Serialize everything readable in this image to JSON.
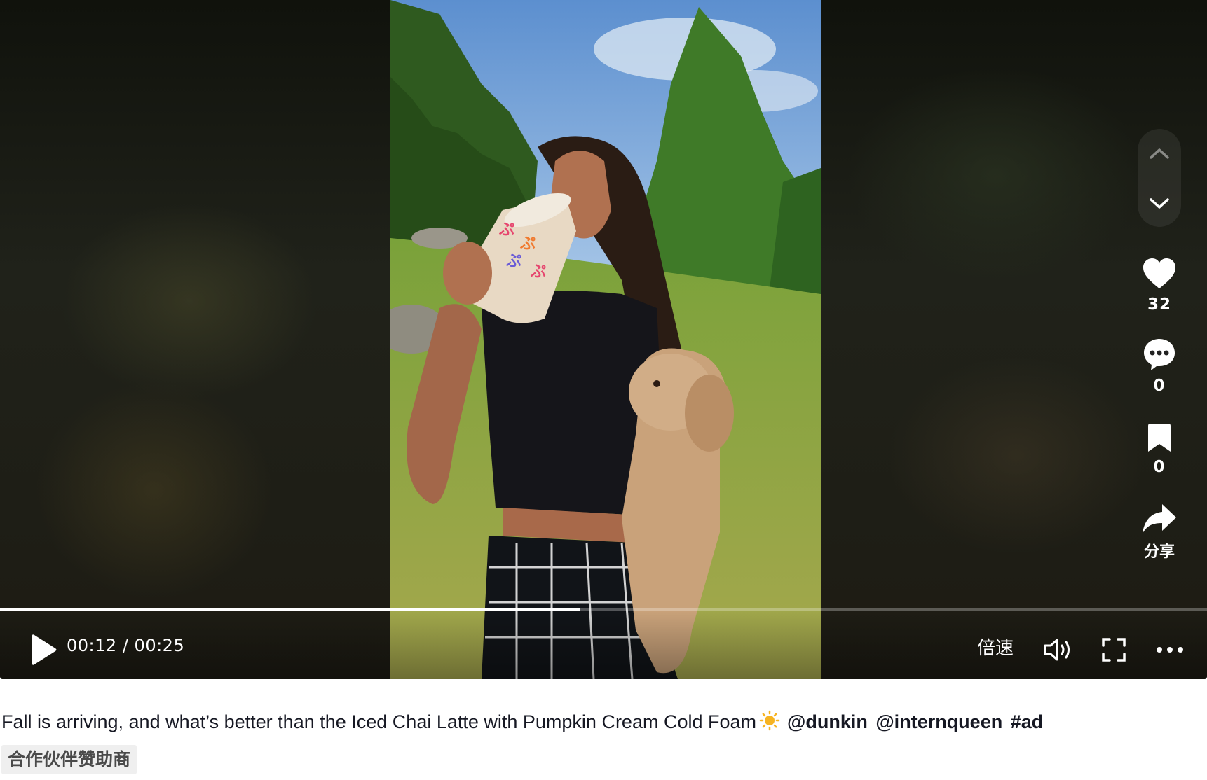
{
  "player": {
    "current_time": "00:12",
    "separator": "/",
    "duration": "00:25",
    "progress_fraction": 0.48,
    "speed_label": "倍速",
    "state": "paused"
  },
  "actions": {
    "likes": "32",
    "comments": "0",
    "favorites": "0",
    "share_label": "分享"
  },
  "caption": {
    "text": "Fall is arriving, and what’s better than the Iced Chai Latte with Pumpkin Cream Cold Foam",
    "emoji": "sun-icon",
    "mentions": [
      "@dunkin",
      "@internqueen",
      "#ad"
    ]
  },
  "badge": {
    "label": "合作伙伴赞助商"
  },
  "colors": {
    "text": "#161823",
    "badge_bg": "#efefef",
    "progress": "#ffffff",
    "player_bg": "#15170f"
  }
}
